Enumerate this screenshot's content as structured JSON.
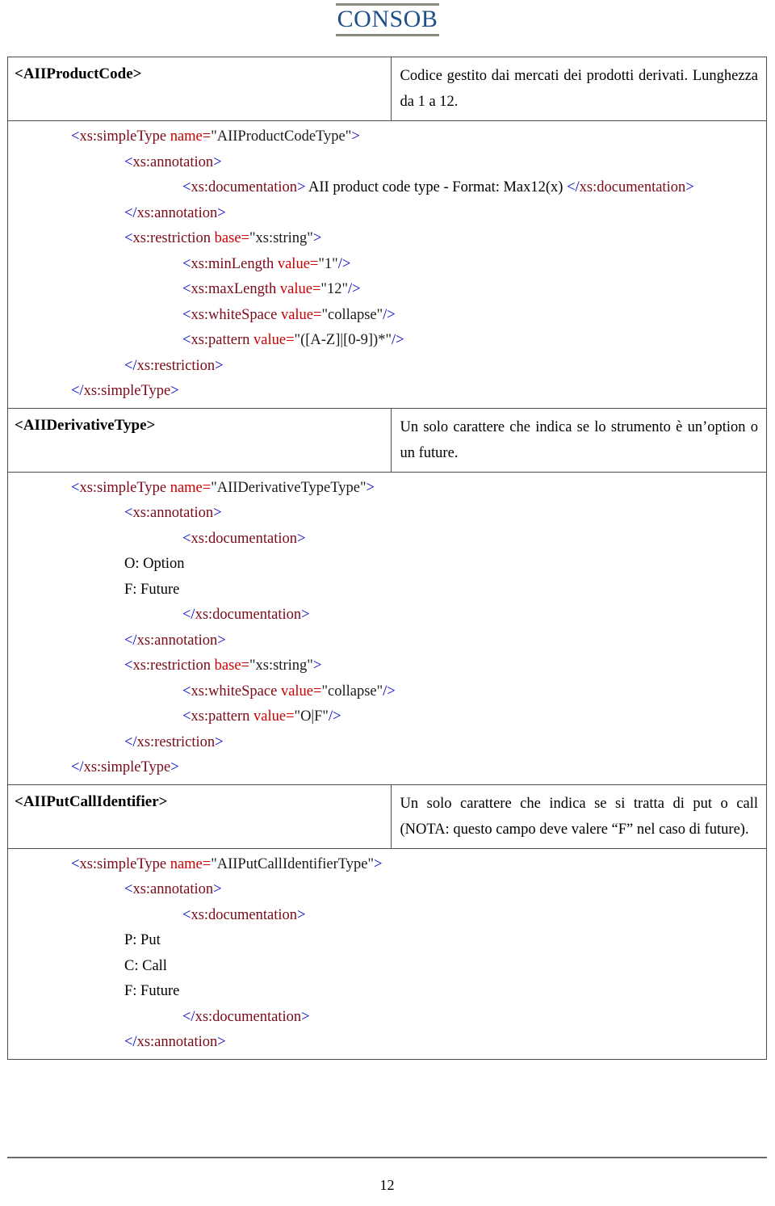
{
  "header": {
    "logo_text": "CONSOB"
  },
  "footer": {
    "page_number": "12"
  },
  "colors": {
    "logo": "#1f4e8c",
    "bracket": "#0000cc",
    "tag_name": "#7a0a18",
    "attribute_name": "#cc0000",
    "attribute_value": "#1a1a1a",
    "table_border": "#4d4d4d"
  },
  "sections": [
    {
      "element_name": "<AIIProductCode>",
      "description": "Codice gestito dai mercati dei prodotti derivati. Lunghezza da 1 a 12.",
      "code": {
        "l1": {
          "b1": "<",
          "t": "xs:simpleType",
          "a": " name=",
          "v": "\"AIIProductCodeType\"",
          "b2": ">"
        },
        "l2": {
          "b1": "<",
          "t": "xs:annotation",
          "b2": ">"
        },
        "l3": {
          "b1": "<",
          "t": "xs:documentation",
          "b2": ">",
          "text": " AII product code type - Format: Max12(x) ",
          "b3": "</",
          "t2": "xs:documentation",
          "b4": ">"
        },
        "l4": {
          "b1": "</",
          "t": "xs:annotation",
          "b2": ">"
        },
        "l5": {
          "b1": "<",
          "t": "xs:restriction",
          "a": " base=",
          "v": "\"xs:string\"",
          "b2": ">"
        },
        "l6": {
          "b1": "<",
          "t": "xs:minLength",
          "a": " value=",
          "v": "\"1\"",
          "b2": "/>"
        },
        "l7": {
          "b1": "<",
          "t": "xs:maxLength",
          "a": " value=",
          "v": "\"12\"",
          "b2": "/>"
        },
        "l8": {
          "b1": "<",
          "t": "xs:whiteSpace",
          "a": " value=",
          "v": "\"collapse\"",
          "b2": "/>"
        },
        "l9": {
          "b1": "<",
          "t": "xs:pattern",
          "a": " value=",
          "v": "\"([A-Z]|[0-9])*\"",
          "b2": "/>"
        },
        "l10": {
          "b1": "</",
          "t": "xs:restriction",
          "b2": ">"
        },
        "l11": {
          "b1": "</",
          "t": "xs:simpleType",
          "b2": ">"
        }
      }
    },
    {
      "element_name": "<AIIDerivativeType>",
      "description": "Un solo carattere che indica se lo strumento è un’option o un future.",
      "code": {
        "l1": {
          "b1": "<",
          "t": "xs:simpleType",
          "a": " name=",
          "v": "\"AIIDerivativeTypeType\"",
          "b2": ">"
        },
        "l2": {
          "b1": "<",
          "t": "xs:annotation",
          "b2": ">"
        },
        "l3": {
          "b1": "<",
          "t": "xs:documentation",
          "b2": ">"
        },
        "l4": {
          "text": "O: Option"
        },
        "l5": {
          "text": "F: Future"
        },
        "l6": {
          "b1": "</",
          "t": "xs:documentation",
          "b2": ">"
        },
        "l7": {
          "b1": "</",
          "t": "xs:annotation",
          "b2": ">"
        },
        "l8": {
          "b1": "<",
          "t": "xs:restriction",
          "a": " base=",
          "v": "\"xs:string\"",
          "b2": ">"
        },
        "l9": {
          "b1": "<",
          "t": "xs:whiteSpace",
          "a": " value=",
          "v": "\"collapse\"",
          "b2": "/>"
        },
        "l10": {
          "b1": "<",
          "t": "xs:pattern",
          "a": " value=",
          "v": "\"O|F\"",
          "b2": "/>"
        },
        "l11": {
          "b1": "</",
          "t": "xs:restriction",
          "b2": ">"
        },
        "l12": {
          "b1": "</",
          "t": "xs:simpleType",
          "b2": ">"
        }
      }
    },
    {
      "element_name": "<AIIPutCallIdentifier>",
      "description": "Un solo carattere che indica se si tratta di put o call (NOTA: questo campo deve valere “F” nel caso di future).",
      "code": {
        "l1": {
          "b1": "<",
          "t": "xs:simpleType",
          "a": " name=",
          "v": "\"AIIPutCallIdentifierType\"",
          "b2": ">"
        },
        "l2": {
          "b1": "<",
          "t": "xs:annotation",
          "b2": ">"
        },
        "l3": {
          "b1": "<",
          "t": "xs:documentation",
          "b2": ">"
        },
        "l4": {
          "text": "P: Put"
        },
        "l5": {
          "text": "C: Call"
        },
        "l6": {
          "text": "F: Future"
        },
        "l7": {
          "b1": "</",
          "t": "xs:documentation",
          "b2": ">"
        },
        "l8": {
          "b1": "</",
          "t": "xs:annotation",
          "b2": ">"
        }
      }
    }
  ]
}
